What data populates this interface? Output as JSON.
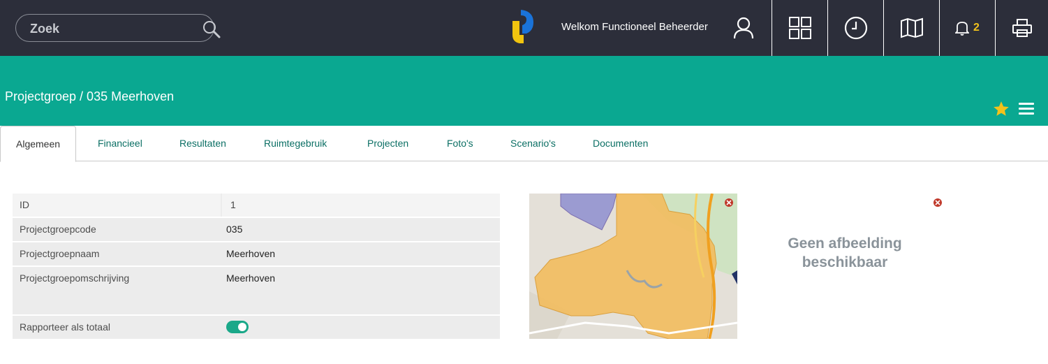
{
  "search": {
    "placeholder": "Zoek"
  },
  "header": {
    "welcome": "Welkom Functioneel Beheerder",
    "notification_count": "2"
  },
  "page": {
    "title": "Projectgroep / 035 Meerhoven"
  },
  "tabs": [
    {
      "label": "Algemeen",
      "active": true
    },
    {
      "label": "Financieel"
    },
    {
      "label": "Resultaten"
    },
    {
      "label": "Ruimtegebruik"
    },
    {
      "label": "Projecten"
    },
    {
      "label": "Foto's"
    },
    {
      "label": "Scenario's"
    },
    {
      "label": "Documenten"
    }
  ],
  "form": {
    "fields": [
      {
        "label": "ID",
        "value": "1"
      },
      {
        "label": "Projectgroepcode",
        "value": "035"
      },
      {
        "label": "Projectgroepnaam",
        "value": "Meerhoven"
      },
      {
        "label": "Projectgroepomschrijving",
        "value": "Meerhoven"
      },
      {
        "label": "Rapporteer als totaal",
        "value_toggle": true
      }
    ]
  },
  "image_panel": {
    "no_image_text": "Geen afbeelding beschikbaar"
  },
  "colors": {
    "topbar": "#2c2e3a",
    "accent": "#0aa891",
    "star": "#f2c21b",
    "toggle": "#1aa889"
  }
}
